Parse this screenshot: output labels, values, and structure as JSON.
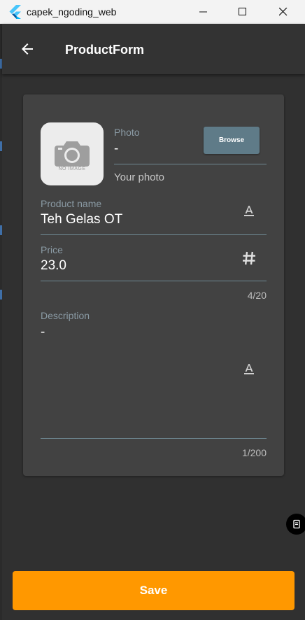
{
  "window": {
    "title": "capek_ngoding_web",
    "app_icon": "flutter-logo",
    "controls": [
      "minimize-icon",
      "maximize-icon",
      "close-icon"
    ]
  },
  "appbar": {
    "title": "ProductForm",
    "back_icon": "arrow-back-icon"
  },
  "form": {
    "photo": {
      "image_placeholder_text": "NO IMAGE",
      "label": "Photo",
      "value": "-",
      "helper": "Your photo",
      "browse_label": "Browse"
    },
    "product_name": {
      "label": "Product name",
      "value": "Teh Gelas OT",
      "icon": "text-format-icon"
    },
    "price": {
      "label": "Price",
      "value": "23.0",
      "icon": "hash-icon",
      "counter": "4/20"
    },
    "description": {
      "label": "Description",
      "value": "-",
      "icon": "text-format-icon",
      "counter": "1/200"
    }
  },
  "save_label": "Save",
  "colors": {
    "background": "#303030",
    "appbar": "#333333",
    "card": "#424242",
    "accent_orange": "#ff9800",
    "browse_button": "#5f7b88",
    "underline": "#6f8893"
  }
}
